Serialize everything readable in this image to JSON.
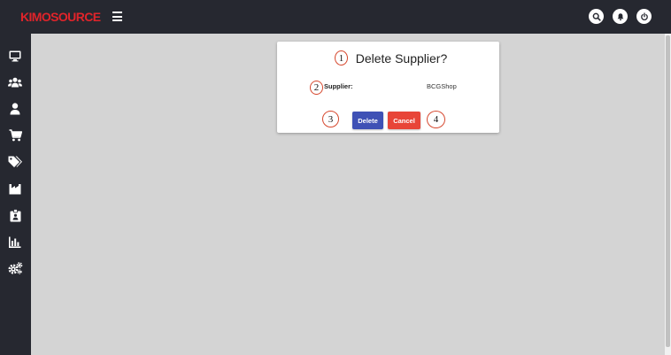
{
  "brand": {
    "logo_text": "KIMOSOURCE",
    "color": "#e0242a"
  },
  "topbar": {
    "menu_icon": "hamburger-menu-icon",
    "actions": [
      {
        "name": "search",
        "icon": "search-icon"
      },
      {
        "name": "notifications",
        "icon": "bell-icon"
      },
      {
        "name": "power",
        "icon": "power-icon"
      }
    ]
  },
  "sidebar": {
    "items": [
      {
        "name": "dashboard",
        "icon": "monitor-icon"
      },
      {
        "name": "users-group",
        "icon": "users-icon"
      },
      {
        "name": "user",
        "icon": "user-icon"
      },
      {
        "name": "cart",
        "icon": "cart-icon"
      },
      {
        "name": "tags",
        "icon": "tags-icon"
      },
      {
        "name": "factory",
        "icon": "factory-icon"
      },
      {
        "name": "id-badge",
        "icon": "id-badge-icon"
      },
      {
        "name": "reports",
        "icon": "bar-chart-icon"
      },
      {
        "name": "settings",
        "icon": "cogs-icon"
      }
    ]
  },
  "dialog": {
    "title": "Delete Supplier?",
    "field_label": "Supplier:",
    "field_value": "BCGShop",
    "delete_label": "Delete",
    "cancel_label": "Cancel",
    "colors": {
      "delete": "#3f51b5",
      "cancel": "#e84538"
    }
  },
  "callouts": [
    "1",
    "2",
    "3",
    "4"
  ]
}
